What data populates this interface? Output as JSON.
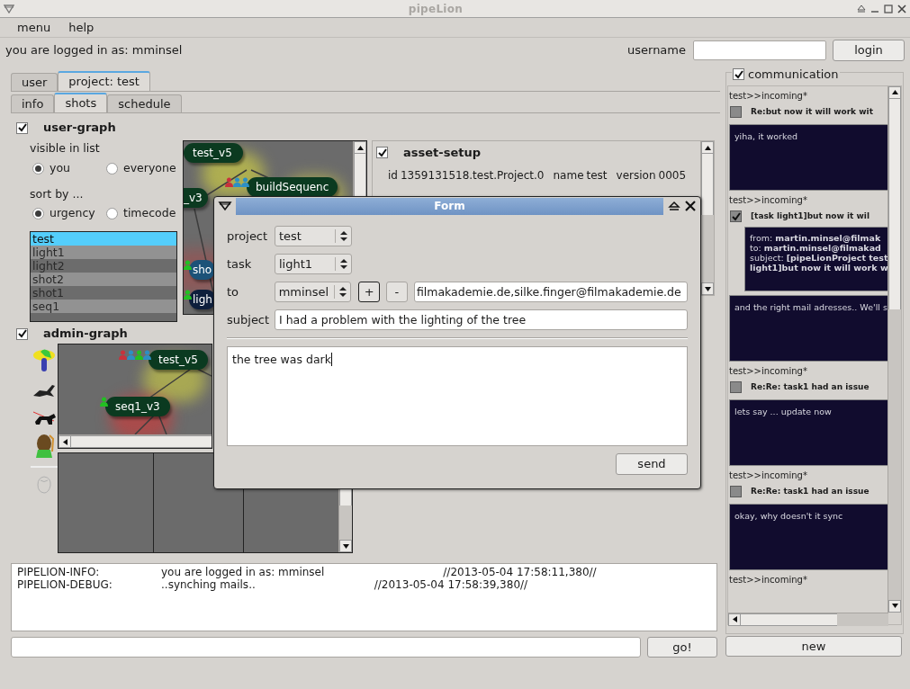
{
  "window": {
    "title": "pipeLion"
  },
  "menu": [
    {
      "label": "menu"
    },
    {
      "label": "help"
    }
  ],
  "login": {
    "status": "you are logged in as: mminsel",
    "username_label": "username",
    "button": "login"
  },
  "tabs": [
    {
      "label": "user",
      "selected": false
    },
    {
      "label": "project: test",
      "selected": true
    }
  ],
  "subtabs": [
    {
      "label": "info",
      "selected": false
    },
    {
      "label": "shots",
      "selected": true
    },
    {
      "label": "schedule",
      "selected": false
    }
  ],
  "user_graph": {
    "checked": true,
    "title": "user-graph",
    "visible_label": "visible in list",
    "visible_options": [
      {
        "label": "you",
        "selected": true
      },
      {
        "label": "everyone",
        "selected": false
      }
    ],
    "sort_label": "sort by ...",
    "sort_options": [
      {
        "label": "urgency",
        "selected": true
      },
      {
        "label": "timecode",
        "selected": false
      }
    ],
    "items": [
      {
        "label": "test",
        "selected": true
      },
      {
        "label": "light1",
        "selected": false
      },
      {
        "label": "light2",
        "selected": false
      },
      {
        "label": "shot2",
        "selected": false
      },
      {
        "label": "shot1",
        "selected": false
      },
      {
        "label": "seq1",
        "selected": false
      }
    ],
    "nodes": [
      {
        "label": "test_v5",
        "color": "#0b3a20"
      },
      {
        "label": "_v3",
        "color": "#0b3a20"
      },
      {
        "label": "buildSequenc",
        "color": "#0b3a20",
        "people": [
          {
            "color": "#c8323c"
          },
          {
            "color": "#2d8fc4"
          },
          {
            "color": "#2d8fc4"
          }
        ]
      },
      {
        "label": "sho",
        "color": "#1c5278",
        "people": [
          {
            "color": "#22c022"
          }
        ]
      },
      {
        "label": "ligh",
        "color": "#0e1f3c",
        "people": [
          {
            "color": "#22c022"
          }
        ]
      }
    ]
  },
  "asset_setup": {
    "checked": true,
    "title": "asset-setup",
    "fields": [
      {
        "label": "id",
        "value": "1359131518.test.Project.0"
      },
      {
        "label": "name",
        "value": "test"
      },
      {
        "label": "version",
        "value": "0005"
      }
    ]
  },
  "admin_graph": {
    "checked": true,
    "title": "admin-graph",
    "nodes": [
      {
        "label": "test_v5",
        "color": "#0b3a20",
        "people": [
          {
            "color": "#c8323c"
          },
          {
            "color": "#2d8fc4"
          },
          {
            "color": "#22c022"
          },
          {
            "color": "#2d8fc4"
          }
        ]
      },
      {
        "label": "seq1_v3",
        "color": "#0b3a20",
        "people": [
          {
            "color": "#22c022"
          }
        ]
      }
    ]
  },
  "log": [
    {
      "source": "PIPELION-INFO:",
      "message": "you are logged in as: mminsel",
      "time": "//2013-05-04 17:58:11,380//"
    },
    {
      "source": "PIPELION-DEBUG:",
      "message": "..synching mails..",
      "time": "//2013-05-04 17:58:39,380//"
    }
  ],
  "command": {
    "button": "go!"
  },
  "communication": {
    "checked": true,
    "title": "communication",
    "new_button": "new",
    "messages": [
      {
        "header": "test>>incoming*",
        "checked": false,
        "subject": "Re:but now it will work wit",
        "body": "yiha, it worked"
      },
      {
        "header": "test>>incoming*",
        "checked": true,
        "subject": "[task light1]but now it wil",
        "details": [
          "from: **martin.minsel@filmak**",
          "to: **martin.minsel@filmakad**",
          "subject: **[pipeLionProject test**",
          "**light1]but now it will work w**"
        ],
        "body": "and the right mail adresses.. We'll s"
      },
      {
        "header": "test>>incoming*",
        "checked": false,
        "subject": "Re:Re: task1 had an issue",
        "body": "lets say ... update now"
      },
      {
        "header": "test>>incoming*",
        "checked": false,
        "subject": "Re:Re: task1 had an issue",
        "body": "okay, why doesn't it sync"
      },
      {
        "header": "test>>incoming*"
      }
    ]
  },
  "form": {
    "title": "Form",
    "project_label": "project",
    "project": "test",
    "task_label": "task",
    "task": "light1",
    "to_label": "to",
    "to": "mminsel",
    "add_button": "+",
    "remove_button": "-",
    "recipients": "filmakademie.de,silke.finger@filmakademie.de",
    "subject_label": "subject",
    "subject": "I had a problem with the lighting of the tree",
    "body": "the tree was dark",
    "send_button": "send"
  }
}
